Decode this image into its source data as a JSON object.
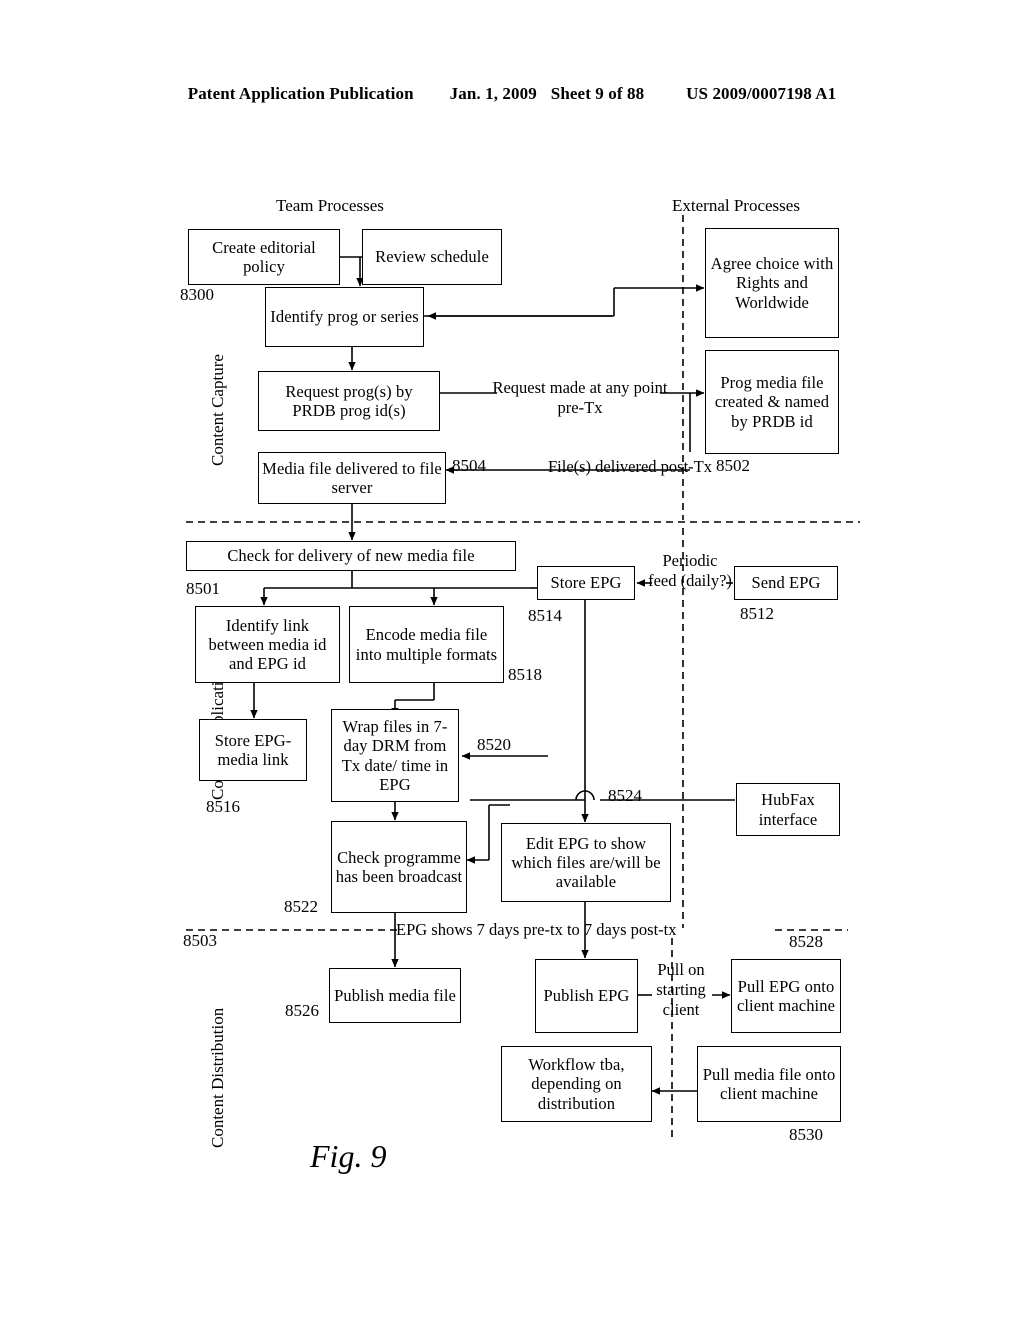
{
  "header": {
    "publication": "Patent Application Publication",
    "date": "Jan. 1, 2009",
    "sheet": "Sheet 9 of 88",
    "patent_number": "US 2009/0007198 A1"
  },
  "figure": {
    "caption": "Fig. 9",
    "column_headings": [
      {
        "id": "team-processes",
        "text": "Team Processes"
      },
      {
        "id": "external-processes",
        "text": "External Processes"
      }
    ],
    "swimlanes": [
      {
        "id": "content-capture",
        "text": "Content Capture"
      },
      {
        "id": "content-publication",
        "text": "Content Publication"
      },
      {
        "id": "content-distribution",
        "text": "Content Distribution"
      }
    ],
    "boxes": [
      {
        "id": "create-editorial-policy",
        "text": "Create editorial policy"
      },
      {
        "id": "review-schedule",
        "text": "Review schedule"
      },
      {
        "id": "identify-prog-or-series",
        "text": "Identify prog or series"
      },
      {
        "id": "request-progs-by-prdb",
        "text": "Request prog(s) by PRDB prog id(s)"
      },
      {
        "id": "media-file-delivered",
        "text": "Media file delivered to file server"
      },
      {
        "id": "agree-choice-rights",
        "text": "Agree choice with Rights and Worldwide"
      },
      {
        "id": "prog-media-file-created",
        "text": "Prog media file created & named by PRDB id"
      },
      {
        "id": "check-for-delivery",
        "text": "Check for delivery of new media file"
      },
      {
        "id": "identify-link",
        "text": "Identify link between media id and EPG id"
      },
      {
        "id": "encode-media",
        "text": "Encode media file into multiple formats"
      },
      {
        "id": "store-epg",
        "text": "Store EPG"
      },
      {
        "id": "send-epg",
        "text": "Send EPG"
      },
      {
        "id": "store-epg-media-link",
        "text": "Store EPG-media link"
      },
      {
        "id": "wrap-files-drm",
        "text": "Wrap files in 7-day DRM from Tx date/ time in EPG"
      },
      {
        "id": "check-programme-broadcast",
        "text": "Check programme has been broadcast"
      },
      {
        "id": "edit-epg-to-show",
        "text": "Edit EPG to show which files are/will be available"
      },
      {
        "id": "hubfax-interface",
        "text": "HubFax interface"
      },
      {
        "id": "publish-media-file",
        "text": "Publish media file"
      },
      {
        "id": "publish-epg",
        "text": "Publish EPG"
      },
      {
        "id": "pull-epg-onto-client",
        "text": "Pull EPG onto client machine"
      },
      {
        "id": "workflow-tba",
        "text": "Workflow tba, depending on distribution"
      },
      {
        "id": "pull-media-file-onto-client",
        "text": "Pull media file onto client machine"
      }
    ],
    "edge_labels": [
      {
        "id": "request-made-pre-tx",
        "text": "Request made at any point pre-Tx"
      },
      {
        "id": "files-delivered-post-tx",
        "text": "File(s) delivered post-Tx"
      },
      {
        "id": "periodic-feed",
        "text": "Periodic feed (daily?)"
      },
      {
        "id": "epg-shows-7-days",
        "text": "EPG shows 7 days pre-tx to 7 days post-tx"
      },
      {
        "id": "pull-on-starting-client",
        "text": "Pull on starting client"
      }
    ],
    "reference_numerals": [
      {
        "id": "ref-8300",
        "text": "8300"
      },
      {
        "id": "ref-8504",
        "text": "8504"
      },
      {
        "id": "ref-8502",
        "text": "8502"
      },
      {
        "id": "ref-8501",
        "text": "8501"
      },
      {
        "id": "ref-8514",
        "text": "8514"
      },
      {
        "id": "ref-8512",
        "text": "8512"
      },
      {
        "id": "ref-8518",
        "text": "8518"
      },
      {
        "id": "ref-8516",
        "text": "8516"
      },
      {
        "id": "ref-8520",
        "text": "8520"
      },
      {
        "id": "ref-8522",
        "text": "8522"
      },
      {
        "id": "ref-8524",
        "text": "8524"
      },
      {
        "id": "ref-8503",
        "text": "8503"
      },
      {
        "id": "ref-8526",
        "text": "8526"
      },
      {
        "id": "ref-8528",
        "text": "8528"
      },
      {
        "id": "ref-8530",
        "text": "8530"
      }
    ]
  }
}
